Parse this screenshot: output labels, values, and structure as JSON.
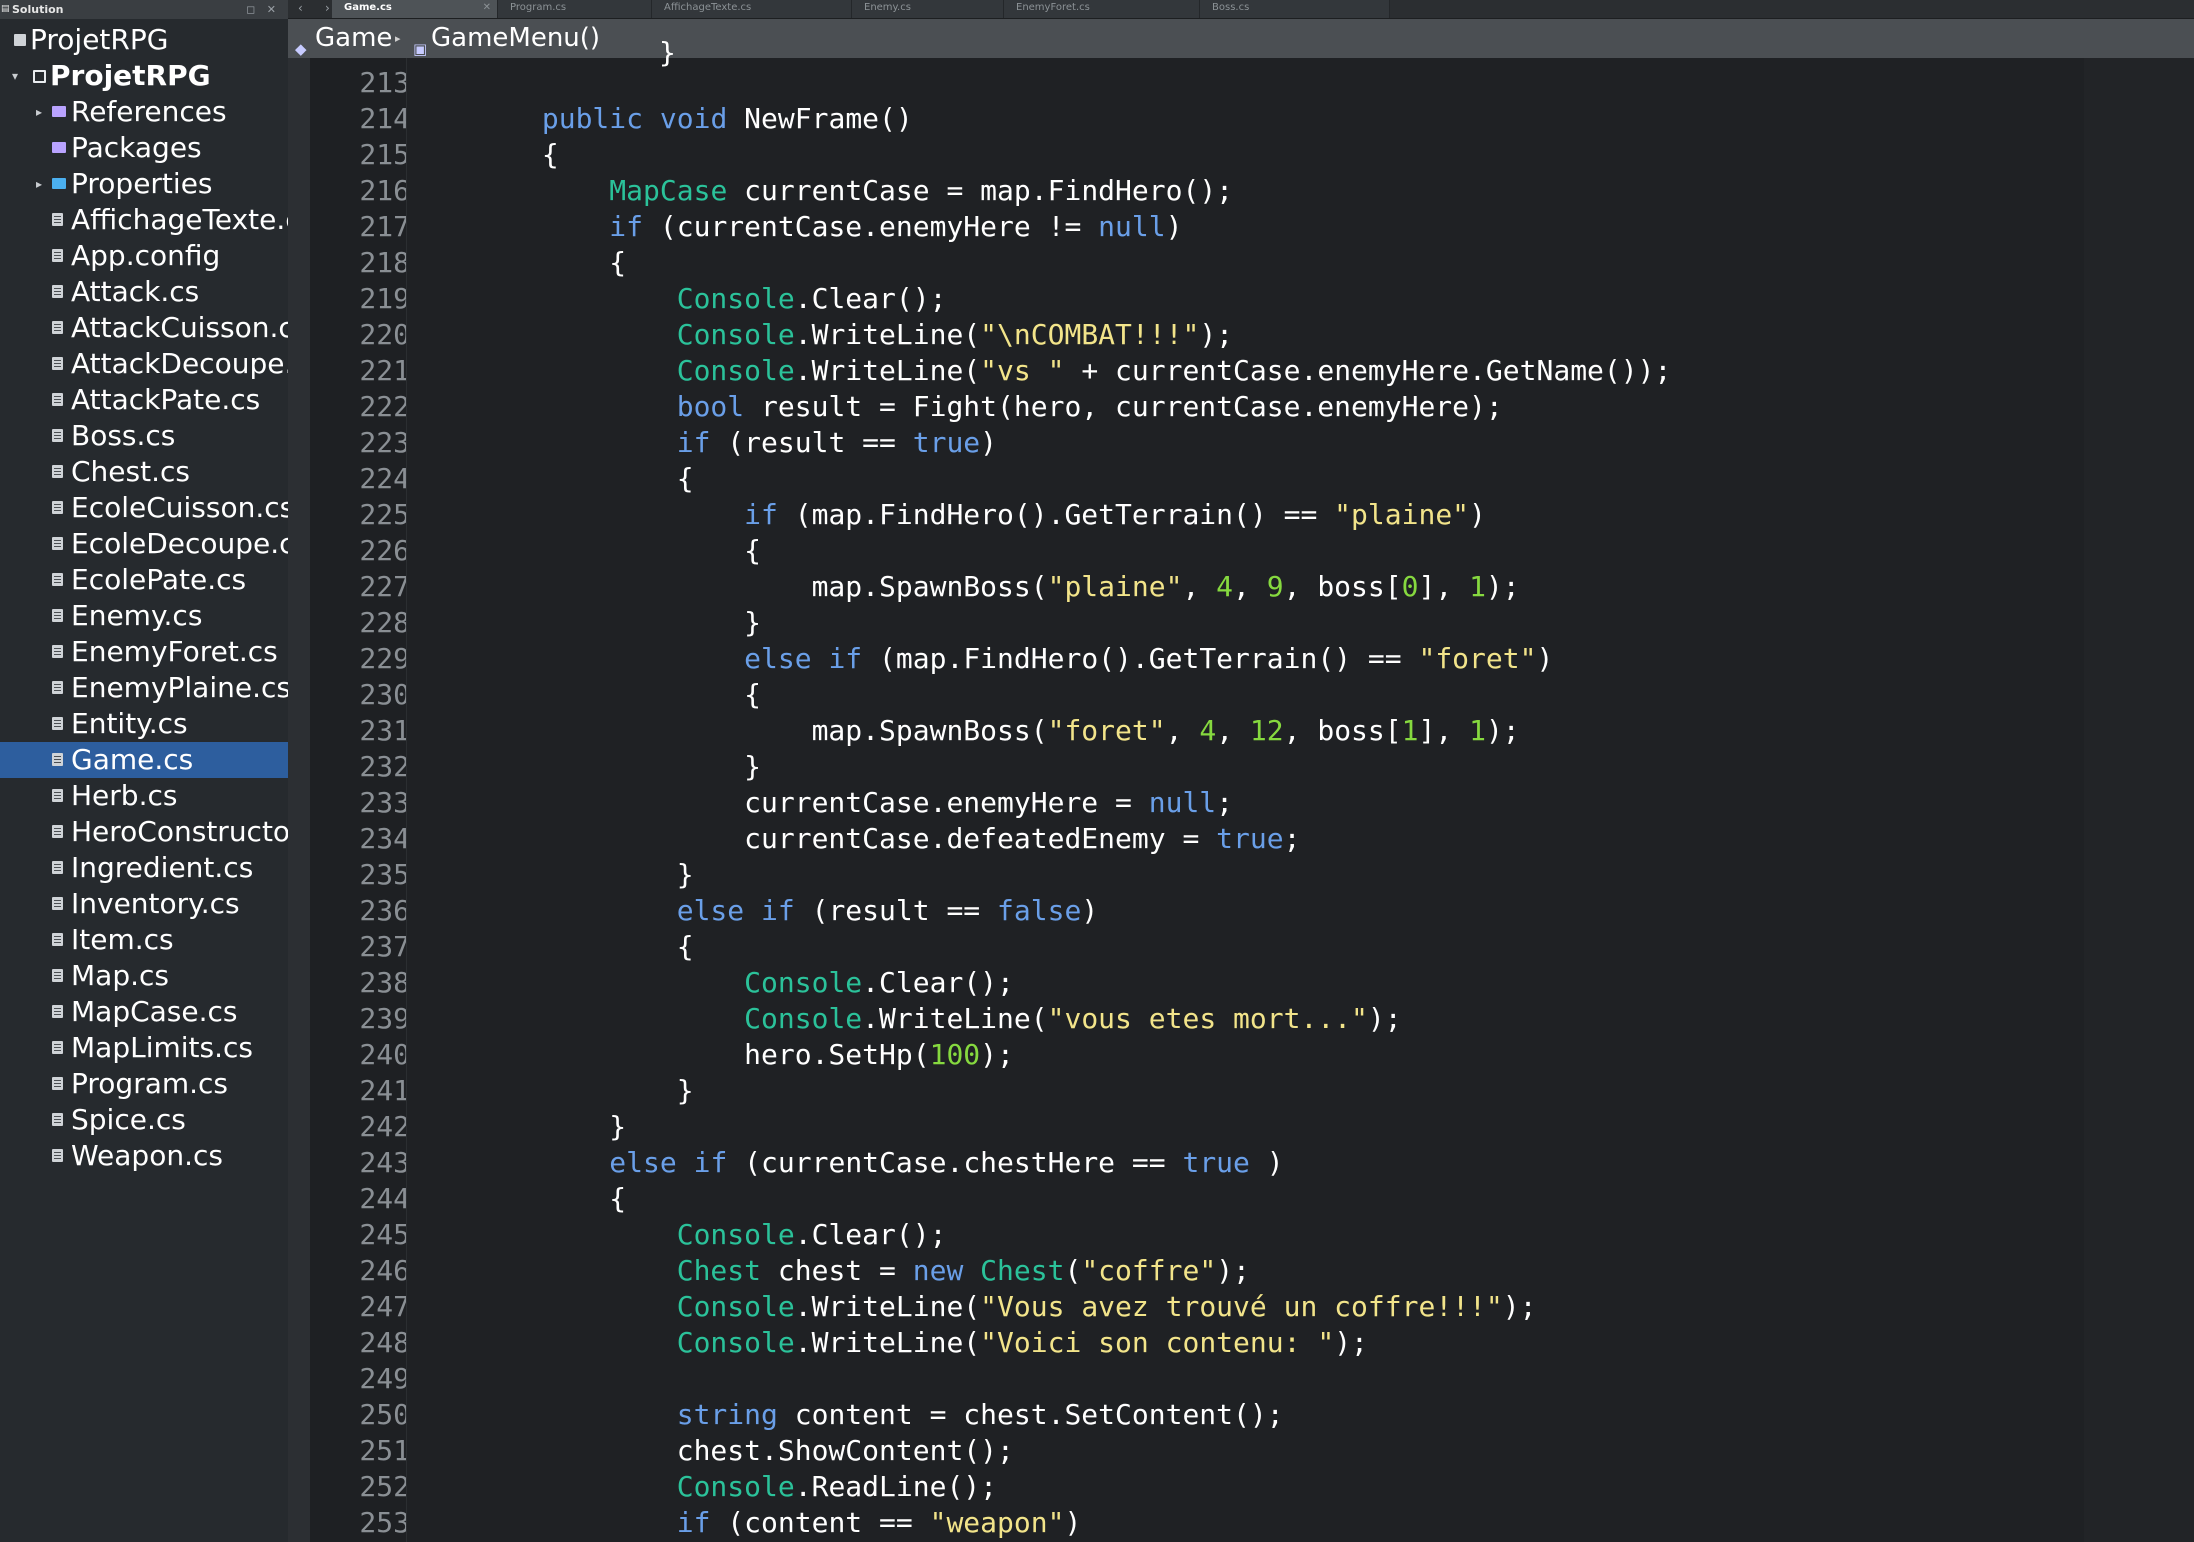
{
  "sidebar": {
    "header_title": "Solution",
    "header_buttons": "◻ ✕",
    "items": [
      {
        "label": "ProjetRPG",
        "depth": 0,
        "icon": "solution-icon",
        "bold": false,
        "arrow": ""
      },
      {
        "label": "ProjetRPG",
        "depth": 0,
        "icon": "project-icon",
        "bold": true,
        "arrow": "▾"
      },
      {
        "label": "References",
        "depth": 1,
        "icon": "folder-icon",
        "bold": false,
        "arrow": "▸"
      },
      {
        "label": "Packages",
        "depth": 1,
        "icon": "folder-icon",
        "bold": false,
        "arrow": ""
      },
      {
        "label": "Properties",
        "depth": 1,
        "icon": "folder-blue-icon",
        "bold": false,
        "arrow": "▸"
      },
      {
        "label": "AffichageTexte.c",
        "depth": 1,
        "icon": "file-icon"
      },
      {
        "label": "App.config",
        "depth": 1,
        "icon": "file-icon"
      },
      {
        "label": "Attack.cs",
        "depth": 1,
        "icon": "file-icon"
      },
      {
        "label": "AttackCuisson.cs",
        "depth": 1,
        "icon": "file-icon"
      },
      {
        "label": "AttackDecoupe.c",
        "depth": 1,
        "icon": "file-icon"
      },
      {
        "label": "AttackPate.cs",
        "depth": 1,
        "icon": "file-icon"
      },
      {
        "label": "Boss.cs",
        "depth": 1,
        "icon": "file-icon"
      },
      {
        "label": "Chest.cs",
        "depth": 1,
        "icon": "file-icon"
      },
      {
        "label": "EcoleCuisson.cs",
        "depth": 1,
        "icon": "file-icon"
      },
      {
        "label": "EcoleDecoupe.cs",
        "depth": 1,
        "icon": "file-icon"
      },
      {
        "label": "EcolePate.cs",
        "depth": 1,
        "icon": "file-icon"
      },
      {
        "label": "Enemy.cs",
        "depth": 1,
        "icon": "file-icon"
      },
      {
        "label": "EnemyForet.cs",
        "depth": 1,
        "icon": "file-icon"
      },
      {
        "label": "EnemyPlaine.cs",
        "depth": 1,
        "icon": "file-icon"
      },
      {
        "label": "Entity.cs",
        "depth": 1,
        "icon": "file-icon"
      },
      {
        "label": "Game.cs",
        "depth": 1,
        "icon": "file-icon",
        "selected": true
      },
      {
        "label": "Herb.cs",
        "depth": 1,
        "icon": "file-icon"
      },
      {
        "label": "HeroConstructor",
        "depth": 1,
        "icon": "file-icon"
      },
      {
        "label": "Ingredient.cs",
        "depth": 1,
        "icon": "file-icon"
      },
      {
        "label": "Inventory.cs",
        "depth": 1,
        "icon": "file-icon"
      },
      {
        "label": "Item.cs",
        "depth": 1,
        "icon": "file-icon"
      },
      {
        "label": "Map.cs",
        "depth": 1,
        "icon": "file-icon"
      },
      {
        "label": "MapCase.cs",
        "depth": 1,
        "icon": "file-icon"
      },
      {
        "label": "MapLimits.cs",
        "depth": 1,
        "icon": "file-icon"
      },
      {
        "label": "Program.cs",
        "depth": 1,
        "icon": "file-icon"
      },
      {
        "label": "Spice.cs",
        "depth": 1,
        "icon": "file-icon"
      },
      {
        "label": "Weapon.cs",
        "depth": 1,
        "icon": "file-icon"
      }
    ]
  },
  "tabs": {
    "nav_back": "‹",
    "nav_forward": "›",
    "items": [
      {
        "label": "Game.cs",
        "active": true,
        "close": "✕"
      },
      {
        "label": "Program.cs",
        "active": false
      },
      {
        "label": "AffichageTexte.cs",
        "active": false
      },
      {
        "label": "Enemy.cs",
        "active": false
      },
      {
        "label": "EnemyForet.cs",
        "active": false
      },
      {
        "label": "Boss.cs",
        "active": false
      }
    ]
  },
  "breadcrumb": {
    "class_label": "Game",
    "method_label": "GameMenu()",
    "class_icon": "class-icon",
    "method_icon": "method-icon",
    "separator": "▸"
  },
  "colors": {
    "keyword": "#6a9fe8",
    "type": "#2bc29a",
    "string": "#f2e48a",
    "number": "#86d93f",
    "plain": "#ffffff",
    "selection": "#2d5e9e"
  },
  "editor": {
    "partial_top_line": "}",
    "lines": [
      {
        "n": "213",
        "t": [
          [
            "",
            "        }"
          ]
        ]
      },
      {
        "n": "214",
        "t": [
          [
            "",
            "        "
          ],
          [
            "kw",
            "public"
          ],
          [
            "",
            " "
          ],
          [
            "kw",
            "void"
          ],
          [
            "",
            " NewFrame()"
          ]
        ]
      },
      {
        "n": "215",
        "t": [
          [
            "",
            "        {"
          ]
        ]
      },
      {
        "n": "216",
        "t": [
          [
            "",
            "            "
          ],
          [
            "type",
            "MapCase"
          ],
          [
            "",
            " currentCase = map.FindHero();"
          ]
        ]
      },
      {
        "n": "217",
        "t": [
          [
            "",
            "            "
          ],
          [
            "kw",
            "if"
          ],
          [
            "",
            " (currentCase.enemyHere != "
          ],
          [
            "kw",
            "null"
          ],
          [
            "",
            ")"
          ]
        ]
      },
      {
        "n": "218",
        "t": [
          [
            "",
            "            {"
          ]
        ]
      },
      {
        "n": "219",
        "t": [
          [
            "",
            "                "
          ],
          [
            "type",
            "Console"
          ],
          [
            "",
            ".Clear();"
          ]
        ]
      },
      {
        "n": "220",
        "t": [
          [
            "",
            "                "
          ],
          [
            "type",
            "Console"
          ],
          [
            "",
            ".WriteLine("
          ],
          [
            "str",
            "\"\\nCOMBAT!!!\""
          ],
          [
            "",
            ");"
          ]
        ]
      },
      {
        "n": "221",
        "t": [
          [
            "",
            "                "
          ],
          [
            "type",
            "Console"
          ],
          [
            "",
            ".WriteLine("
          ],
          [
            "str",
            "\"vs \""
          ],
          [
            "",
            " + currentCase.enemyHere.GetName());"
          ]
        ]
      },
      {
        "n": "222",
        "t": [
          [
            "",
            "                "
          ],
          [
            "kw",
            "bool"
          ],
          [
            "",
            " result = Fight(hero, currentCase.enemyHere);"
          ]
        ]
      },
      {
        "n": "223",
        "t": [
          [
            "",
            "                "
          ],
          [
            "kw",
            "if"
          ],
          [
            "",
            " (result == "
          ],
          [
            "kw",
            "true"
          ],
          [
            "",
            ")"
          ]
        ]
      },
      {
        "n": "224",
        "t": [
          [
            "",
            "                {"
          ]
        ]
      },
      {
        "n": "225",
        "t": [
          [
            "",
            "                    "
          ],
          [
            "kw",
            "if"
          ],
          [
            "",
            " (map.FindHero().GetTerrain() == "
          ],
          [
            "str",
            "\"plaine\""
          ],
          [
            "",
            ")"
          ]
        ]
      },
      {
        "n": "226",
        "t": [
          [
            "",
            "                    {"
          ]
        ]
      },
      {
        "n": "227",
        "t": [
          [
            "",
            "                        map.SpawnBoss("
          ],
          [
            "str",
            "\"plaine\""
          ],
          [
            "",
            ", "
          ],
          [
            "num",
            "4"
          ],
          [
            "",
            ", "
          ],
          [
            "num",
            "9"
          ],
          [
            "",
            ", boss["
          ],
          [
            "num",
            "0"
          ],
          [
            "",
            "], "
          ],
          [
            "num",
            "1"
          ],
          [
            "",
            ");"
          ]
        ]
      },
      {
        "n": "228",
        "t": [
          [
            "",
            "                    }"
          ]
        ]
      },
      {
        "n": "229",
        "t": [
          [
            "",
            "                    "
          ],
          [
            "kw",
            "else"
          ],
          [
            "",
            " "
          ],
          [
            "kw",
            "if"
          ],
          [
            "",
            " (map.FindHero().GetTerrain() == "
          ],
          [
            "str",
            "\"foret\""
          ],
          [
            "",
            ")"
          ]
        ]
      },
      {
        "n": "230",
        "t": [
          [
            "",
            "                    {"
          ]
        ]
      },
      {
        "n": "231",
        "t": [
          [
            "",
            "                        map.SpawnBoss("
          ],
          [
            "str",
            "\"foret\""
          ],
          [
            "",
            ", "
          ],
          [
            "num",
            "4"
          ],
          [
            "",
            ", "
          ],
          [
            "num",
            "12"
          ],
          [
            "",
            ", boss["
          ],
          [
            "num",
            "1"
          ],
          [
            "",
            "], "
          ],
          [
            "num",
            "1"
          ],
          [
            "",
            ");"
          ]
        ]
      },
      {
        "n": "232",
        "t": [
          [
            "",
            "                    }"
          ]
        ]
      },
      {
        "n": "233",
        "t": [
          [
            "",
            "                    currentCase.enemyHere = "
          ],
          [
            "kw",
            "null"
          ],
          [
            "",
            ";"
          ]
        ]
      },
      {
        "n": "234",
        "t": [
          [
            "",
            "                    currentCase.defeatedEnemy = "
          ],
          [
            "kw",
            "true"
          ],
          [
            "",
            ";"
          ]
        ]
      },
      {
        "n": "235",
        "t": [
          [
            "",
            "                }"
          ]
        ]
      },
      {
        "n": "236",
        "t": [
          [
            "",
            "                "
          ],
          [
            "kw",
            "else"
          ],
          [
            "",
            " "
          ],
          [
            "kw",
            "if"
          ],
          [
            "",
            " (result == "
          ],
          [
            "kw",
            "false"
          ],
          [
            "",
            ")"
          ]
        ]
      },
      {
        "n": "237",
        "t": [
          [
            "",
            "                {"
          ]
        ]
      },
      {
        "n": "238",
        "t": [
          [
            "",
            "                    "
          ],
          [
            "type",
            "Console"
          ],
          [
            "",
            ".Clear();"
          ]
        ]
      },
      {
        "n": "239",
        "t": [
          [
            "",
            "                    "
          ],
          [
            "type",
            "Console"
          ],
          [
            "",
            ".WriteLine("
          ],
          [
            "str",
            "\"vous etes mort...\""
          ],
          [
            "",
            ");"
          ]
        ]
      },
      {
        "n": "240",
        "t": [
          [
            "",
            "                    hero.SetHp("
          ],
          [
            "num",
            "100"
          ],
          [
            "",
            ");"
          ]
        ]
      },
      {
        "n": "241",
        "t": [
          [
            "",
            "                }"
          ]
        ]
      },
      {
        "n": "242",
        "t": [
          [
            "",
            "            }"
          ]
        ]
      },
      {
        "n": "243",
        "t": [
          [
            "",
            "            "
          ],
          [
            "kw",
            "else"
          ],
          [
            "",
            " "
          ],
          [
            "kw",
            "if"
          ],
          [
            "",
            " (currentCase.chestHere == "
          ],
          [
            "kw",
            "true"
          ],
          [
            "",
            " )"
          ]
        ]
      },
      {
        "n": "244",
        "t": [
          [
            "",
            "            {"
          ]
        ]
      },
      {
        "n": "245",
        "t": [
          [
            "",
            "                "
          ],
          [
            "type",
            "Console"
          ],
          [
            "",
            ".Clear();"
          ]
        ]
      },
      {
        "n": "246",
        "t": [
          [
            "",
            "                "
          ],
          [
            "type",
            "Chest"
          ],
          [
            "",
            " chest = "
          ],
          [
            "kw",
            "new"
          ],
          [
            "",
            " "
          ],
          [
            "type",
            "Chest"
          ],
          [
            "",
            "("
          ],
          [
            "str",
            "\"coffre\""
          ],
          [
            "",
            ");"
          ]
        ]
      },
      {
        "n": "247",
        "t": [
          [
            "",
            "                "
          ],
          [
            "type",
            "Console"
          ],
          [
            "",
            ".WriteLine("
          ],
          [
            "str",
            "\"Vous avez trouvé un coffre!!!\""
          ],
          [
            "",
            ");"
          ]
        ]
      },
      {
        "n": "248",
        "t": [
          [
            "",
            "                "
          ],
          [
            "type",
            "Console"
          ],
          [
            "",
            ".WriteLine("
          ],
          [
            "str",
            "\"Voici son contenu: \""
          ],
          [
            "",
            ");"
          ]
        ]
      },
      {
        "n": "249",
        "t": [
          [
            "",
            ""
          ]
        ]
      },
      {
        "n": "250",
        "t": [
          [
            "",
            "                "
          ],
          [
            "kw",
            "string"
          ],
          [
            "",
            " content = chest.SetContent();"
          ]
        ]
      },
      {
        "n": "251",
        "t": [
          [
            "",
            "                chest.ShowContent();"
          ]
        ]
      },
      {
        "n": "252",
        "t": [
          [
            "",
            "                "
          ],
          [
            "type",
            "Console"
          ],
          [
            "",
            ".ReadLine();"
          ]
        ]
      },
      {
        "n": "253",
        "t": [
          [
            "",
            "                "
          ],
          [
            "kw",
            "if"
          ],
          [
            "",
            " (content == "
          ],
          [
            "str",
            "\"weapon\""
          ],
          [
            "",
            ")"
          ]
        ]
      }
    ]
  }
}
